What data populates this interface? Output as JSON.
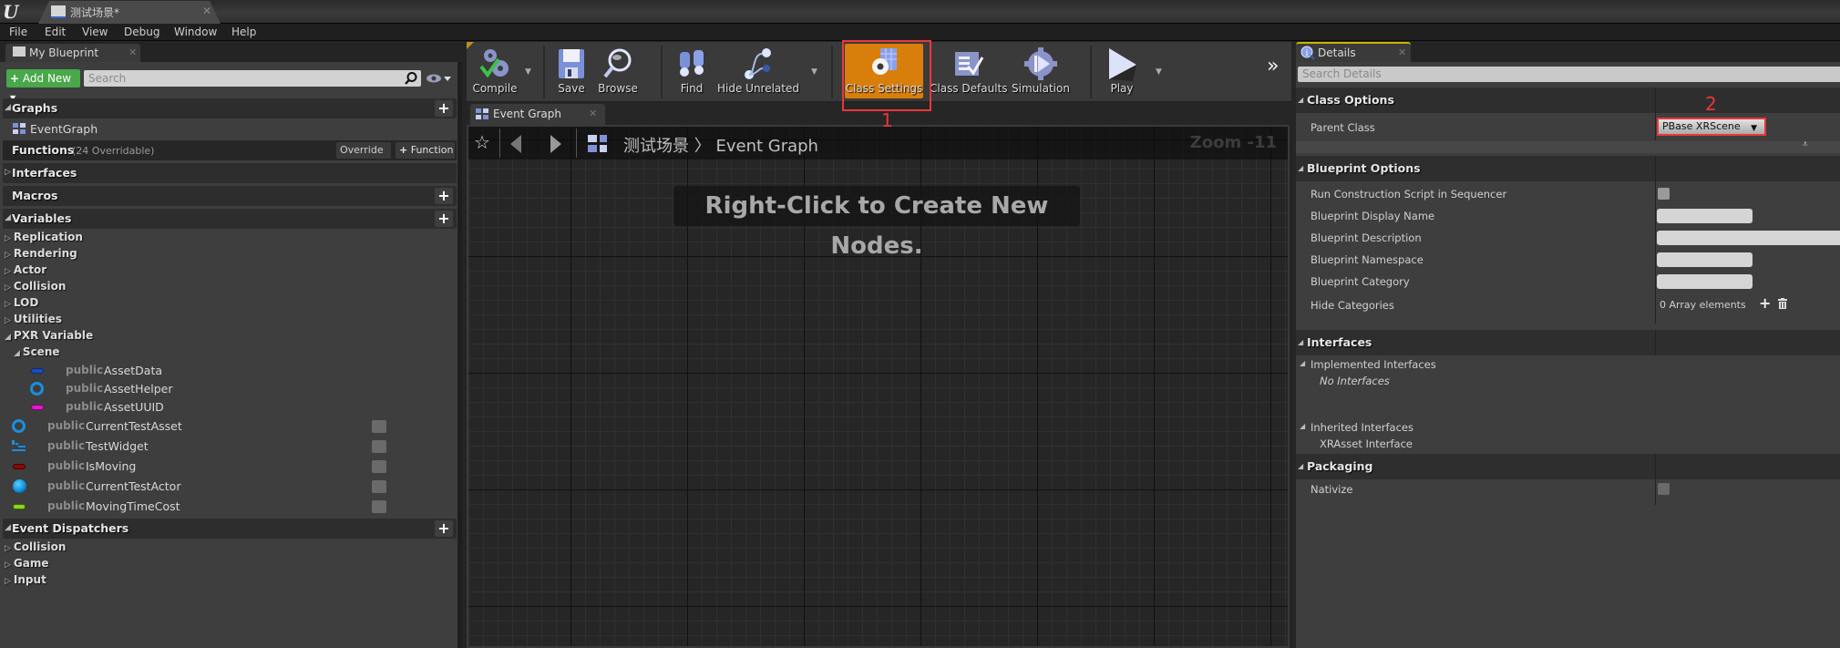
{
  "window": {
    "doc_tab_title": "测试场景*",
    "logo": "U"
  },
  "menu": [
    "File",
    "Edit",
    "View",
    "Debug",
    "Window",
    "Help"
  ],
  "my_blueprint": {
    "tab_label": "My Blueprint",
    "add_new_label": "Add New",
    "search_placeholder": "Search",
    "sections": {
      "graphs": "Graphs",
      "event_graph_item": "EventGraph",
      "functions": "Functions",
      "functions_count": "(24 Overridable)",
      "override_label": "Override",
      "function_label": "Function",
      "interfaces": "Interfaces",
      "macros": "Macros",
      "variables": "Variables",
      "event_dispatchers": "Event Dispatchers"
    },
    "variable_categories": [
      "Replication",
      "Rendering",
      "Actor",
      "Collision",
      "LOD",
      "Utilities"
    ],
    "pxr_category": "PXR Variable",
    "scene_category": "Scene",
    "scene_vars": [
      {
        "access": "public",
        "name": "AssetData",
        "type_icon": "struct-pill",
        "color": "#1a4fb8"
      },
      {
        "access": "public",
        "name": "AssetHelper",
        "type_icon": "object-ring",
        "color": "#1a8ee0"
      },
      {
        "access": "public",
        "name": "AssetUUID",
        "type_icon": "string-pill",
        "color": "#e01ad0"
      }
    ],
    "vars": [
      {
        "access": "public",
        "name": "CurrentTestAsset",
        "type_icon": "object-ring",
        "color": "#1a8ee0"
      },
      {
        "access": "public",
        "name": "TestWidget",
        "type_icon": "widget-icon",
        "color": "#1a8ee0"
      },
      {
        "access": "public",
        "name": "IsMoving",
        "type_icon": "bool-pill",
        "color": "#8a0a0a"
      },
      {
        "access": "public",
        "name": "CurrentTestActor",
        "type_icon": "actor-ball",
        "color": "#16a6ea"
      },
      {
        "access": "public",
        "name": "MovingTimeCost",
        "type_icon": "float-pill",
        "color": "#8ad61e"
      }
    ],
    "dispatcher_categories": [
      "Collision",
      "Game",
      "Input"
    ]
  },
  "toolbar": {
    "buttons": [
      {
        "label": "Compile",
        "icon": "compile-gears-check-icon"
      },
      {
        "label": "Save",
        "icon": "floppy-disk-icon"
      },
      {
        "label": "Browse",
        "icon": "magnifier-icon"
      },
      {
        "label": "Find",
        "icon": "binoculars-icon"
      },
      {
        "label": "Hide Unrelated",
        "icon": "hide-unrelated-nodes-icon"
      },
      {
        "label": "Class Settings",
        "icon": "class-settings-gear-icon",
        "active": true
      },
      {
        "label": "Class Defaults",
        "icon": "class-defaults-checklist-icon"
      },
      {
        "label": "Simulation",
        "icon": "simulation-gear-play-icon"
      },
      {
        "label": "Play",
        "icon": "play-triangle-icon"
      }
    ],
    "overflow": "»",
    "active_color": "#d87e0a"
  },
  "graph": {
    "tab_label": "Event Graph",
    "breadcrumb_root": "测试场景",
    "breadcrumb_sep": "〉",
    "breadcrumb_leaf": "Event Graph",
    "zoom_label": "Zoom -11",
    "hint": "Right-Click to Create New Nodes."
  },
  "details": {
    "tab_label": "Details",
    "search_placeholder": "Search Details",
    "class_options": {
      "title": "Class Options",
      "parent_class_label": "Parent Class",
      "parent_class_value": "PBase XRScene"
    },
    "blueprint_options": {
      "title": "Blueprint Options",
      "run_construction_label": "Run Construction Script in Sequencer",
      "run_construction_checked": false,
      "display_name_label": "Blueprint Display Name",
      "display_name_value": "",
      "description_label": "Blueprint Description",
      "description_value": "",
      "namespace_label": "Blueprint Namespace",
      "namespace_value": "",
      "category_label": "Blueprint Category",
      "category_value": "",
      "hide_categories_label": "Hide Categories",
      "hide_categories_value": "0 Array elements"
    },
    "interfaces": {
      "title": "Interfaces",
      "implemented_label": "Implemented Interfaces",
      "implemented_value": "No Interfaces",
      "inherited_label": "Inherited Interfaces",
      "inherited_value": "XRAsset Interface"
    },
    "packaging": {
      "title": "Packaging",
      "nativize_label": "Nativize",
      "nativize_checked": false
    }
  },
  "annotations": {
    "step1": "1",
    "step2": "2",
    "highlight_color": "#e8383a"
  }
}
